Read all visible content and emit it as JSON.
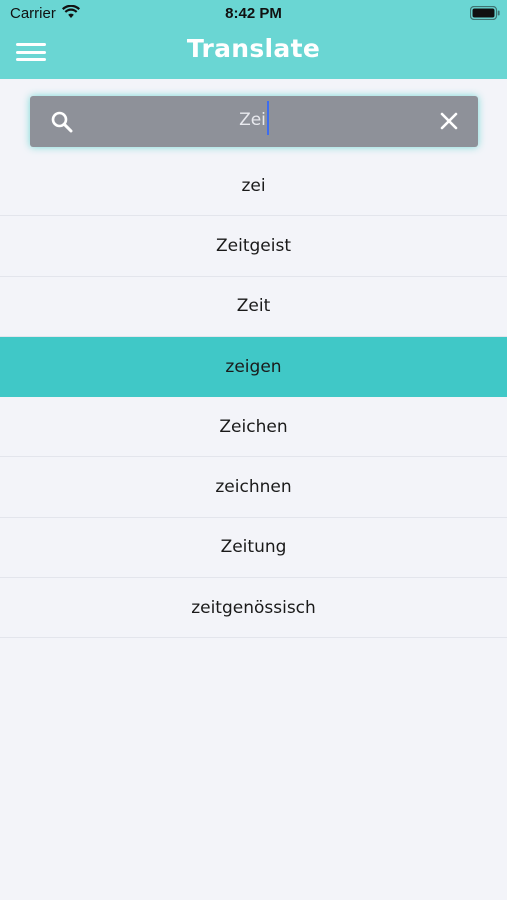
{
  "status_bar": {
    "carrier": "Carrier",
    "time": "8:42 PM",
    "wifi_icon": "wifi-icon",
    "battery_icon": "battery-icon"
  },
  "header": {
    "title": "Translate",
    "menu_icon": "hamburger-menu-icon",
    "background_color": "#6ad6d3"
  },
  "search": {
    "value": "Zei",
    "search_icon": "search-icon",
    "clear_icon": "close-icon"
  },
  "results": {
    "selected_index": 3,
    "highlight_color": "#40c8c7",
    "items": [
      {
        "label": "zei"
      },
      {
        "label": "Zeitgeist"
      },
      {
        "label": "Zeit"
      },
      {
        "label": "zeigen"
      },
      {
        "label": "Zeichen"
      },
      {
        "label": "zeichnen"
      },
      {
        "label": "Zeitung"
      },
      {
        "label": "zeitgenössisch"
      }
    ]
  }
}
